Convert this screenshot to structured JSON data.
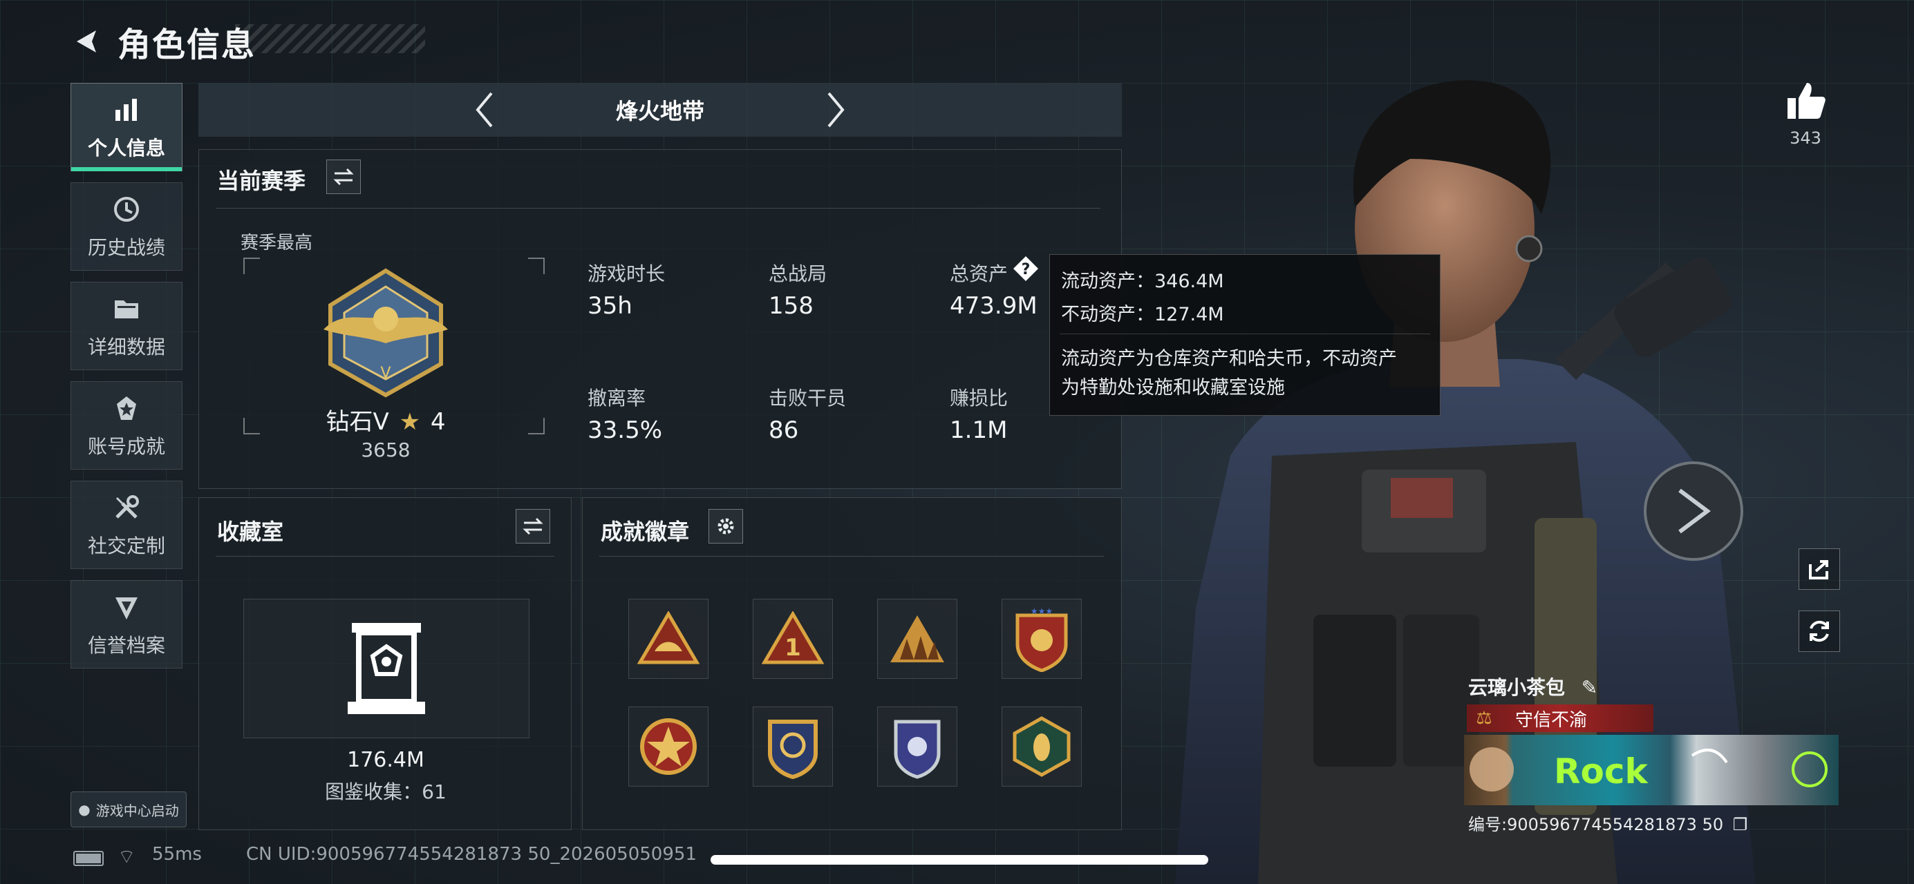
{
  "header": {
    "title": "角色信息"
  },
  "sidebar": {
    "items": [
      {
        "label": "个人信息",
        "icon": "bar-chart-icon",
        "active": true
      },
      {
        "label": "历史战绩",
        "icon": "history-icon"
      },
      {
        "label": "详细数据",
        "icon": "folder-icon"
      },
      {
        "label": "账号成就",
        "icon": "achievement-icon"
      },
      {
        "label": "社交定制",
        "icon": "tools-icon"
      },
      {
        "label": "信誉档案",
        "icon": "credit-shield-icon"
      }
    ],
    "game_center": "游戏中心启动"
  },
  "mode": {
    "title": "烽火地带"
  },
  "season": {
    "title": "当前赛季",
    "best_label": "赛季最高",
    "rank": "钻石V",
    "stars": "4",
    "score": "3658",
    "stats": [
      {
        "label": "游戏时长",
        "value": "35h"
      },
      {
        "label": "总战局",
        "value": "158"
      },
      {
        "label": "总资产",
        "value": "473.9M"
      },
      {
        "label": "撤离率",
        "value": "33.5%"
      },
      {
        "label": "击败干员",
        "value": "86"
      },
      {
        "label": "赚损比",
        "value": "1.1M"
      }
    ]
  },
  "tooltip": {
    "liquid": "流动资产：346.4M",
    "fixed": "不动资产：127.4M",
    "desc1": "流动资产为仓库资产和哈夫币，不动资产",
    "desc2": "为特勤处设施和收藏室设施"
  },
  "collection": {
    "title": "收藏室",
    "value": "176.4M",
    "catalog": "图鉴收集：61"
  },
  "badges": {
    "title": "成就徽章",
    "items": [
      "badge-1",
      "badge-2",
      "badge-3",
      "badge-4",
      "badge-5",
      "badge-6",
      "badge-7",
      "badge-8"
    ]
  },
  "profile": {
    "likes": "343",
    "name": "云璃小茶包",
    "title_tag": "守信不渝",
    "id": "编号:900596774554281873 50"
  },
  "status": {
    "ping": "55ms",
    "uid": "CN UID:900596774554281873 50_202605050951"
  },
  "colors": {
    "accent": "#3fd6a6",
    "tag_red": "#8a1c1c",
    "gold": "#c9a24a"
  }
}
